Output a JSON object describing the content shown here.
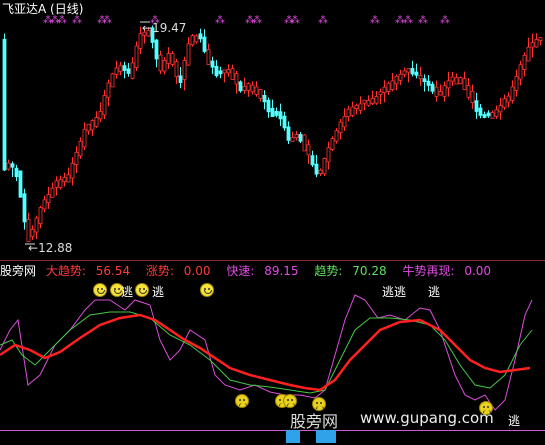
{
  "main_panel": {
    "stock_title": "飞亚达A",
    "period": "(日线)",
    "high_label": "19.47",
    "low_label": "12.88",
    "signal_marks": [
      "⁂",
      "⁂",
      "⁂",
      "⁂",
      "⁂",
      "⁂",
      "⁂",
      "⁂",
      "⁂",
      "⁂",
      "⁂",
      "⁂",
      "⁂",
      "⁂",
      "⁂",
      "⁂",
      "⁂",
      "⁂"
    ]
  },
  "indicator_panel": {
    "name": "股旁网",
    "items": [
      {
        "label": "大趋势:",
        "value": "56.54",
        "color": "#ff3a3a"
      },
      {
        "label": "涨势:",
        "value": "0.00",
        "color": "#ff3a3a"
      },
      {
        "label": "快速:",
        "value": "89.15",
        "color": "#e24ae2"
      },
      {
        "label": "趋势:",
        "value": "70.28",
        "color": "#5ee05e"
      },
      {
        "label": "牛势再现:",
        "value": "0.00",
        "color": "#e24ae2"
      }
    ],
    "escape_label": "逃",
    "escape_label_double": "逃逃"
  },
  "watermark": {
    "text": "股旁网",
    "url": "www.gupang.com"
  },
  "colors": {
    "up_candle": "#ff3232",
    "down_candle": "#54ffff",
    "big_trend": "#ff2020",
    "fast": "#d94fd9",
    "trend": "#46c846",
    "signal": "#e04ae0",
    "blue_bar": "#2fa2ea"
  }
}
